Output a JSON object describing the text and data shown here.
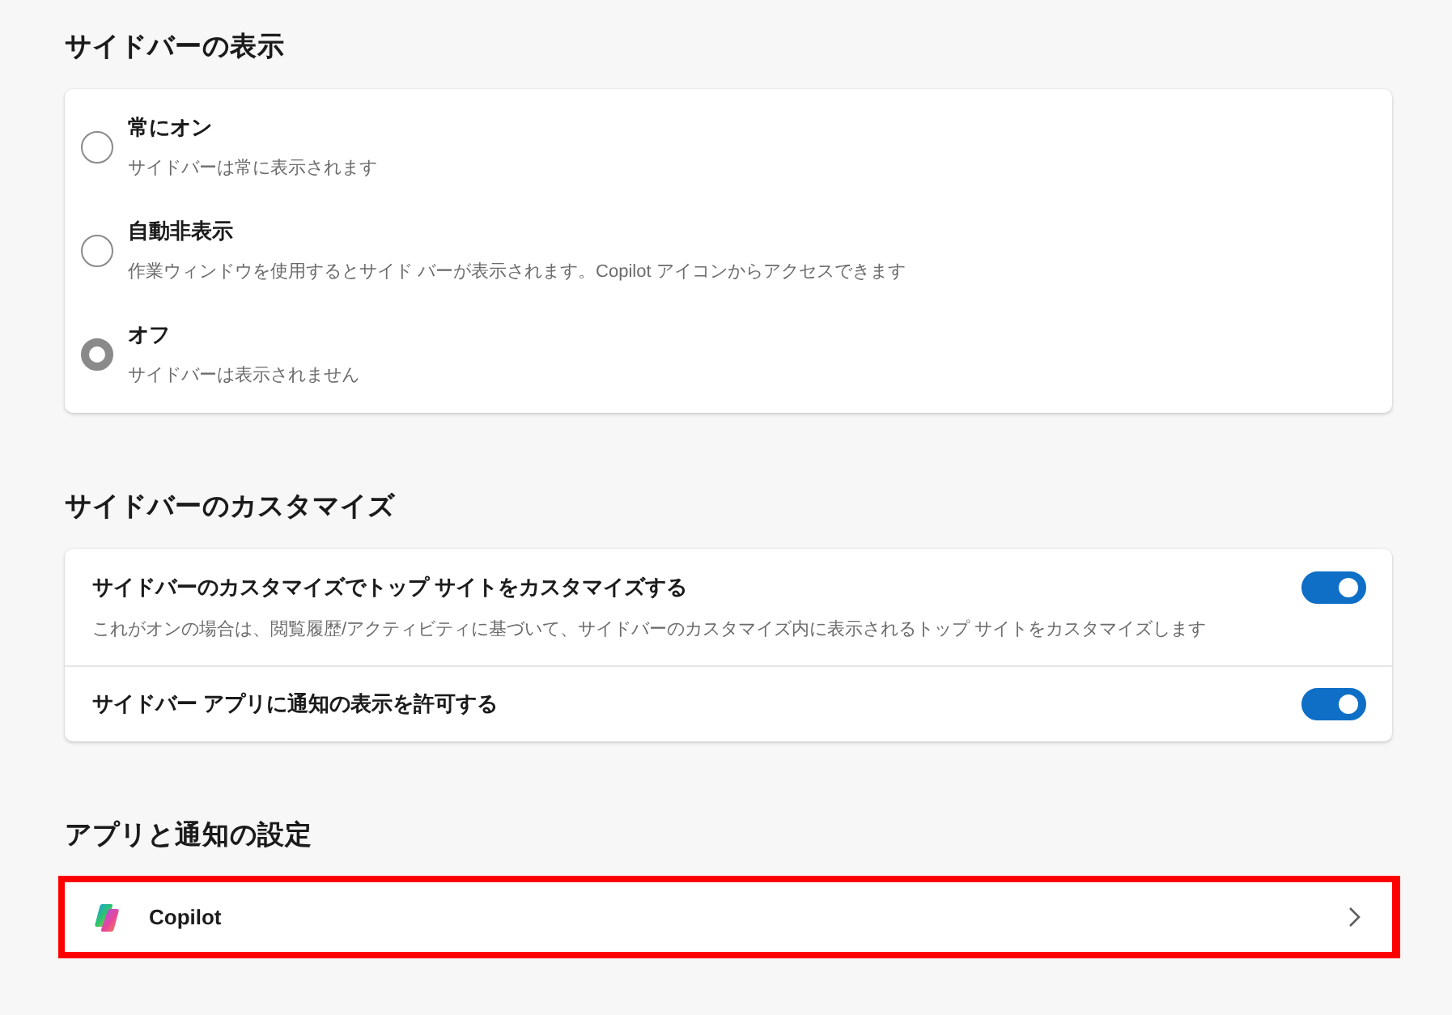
{
  "sections": [
    {
      "kind": "radio-group",
      "title": "サイドバーの表示",
      "options": [
        {
          "label": "常にオン",
          "description": "サイドバーは常に表示されます",
          "selected": false
        },
        {
          "label": "自動非表示",
          "description": "作業ウィンドウを使用するとサイド バーが表示されます。Copilot アイコンからアクセスできます",
          "selected": false
        },
        {
          "label": "オフ",
          "description": "サイドバーは表示されません",
          "selected": true
        }
      ]
    },
    {
      "kind": "toggle-list",
      "title": "サイドバーのカスタマイズ",
      "settings": [
        {
          "label": "サイドバーのカスタマイズでトップ サイトをカスタマイズする",
          "description": "これがオンの場合は、閲覧履歴/アクティビティに基づいて、サイドバーのカスタマイズ内に表示されるトップ サイトをカスタマイズします",
          "on": true
        },
        {
          "label": "サイドバー アプリに通知の表示を許可する",
          "on": true
        }
      ]
    },
    {
      "kind": "link-list",
      "title": "アプリと通知の設定",
      "items": [
        {
          "label": "Copilot",
          "highlighted": true
        }
      ]
    }
  ]
}
